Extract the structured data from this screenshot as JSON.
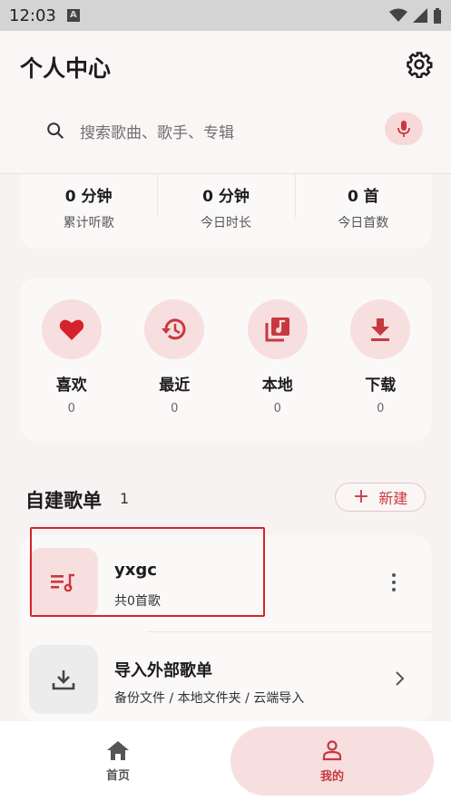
{
  "status_bar": {
    "time": "12:03"
  },
  "header": {
    "title": "个人中心",
    "search_placeholder": "搜索歌曲、歌手、专辑"
  },
  "stats": [
    {
      "value": "0 分钟",
      "label": "累计听歌"
    },
    {
      "value": "0 分钟",
      "label": "今日时长"
    },
    {
      "value": "0 首",
      "label": "今日首数"
    }
  ],
  "quick": [
    {
      "label": "喜欢",
      "count": "0",
      "icon": "heart-icon"
    },
    {
      "label": "最近",
      "count": "0",
      "icon": "history-icon"
    },
    {
      "label": "本地",
      "count": "0",
      "icon": "library-music-icon"
    },
    {
      "label": "下载",
      "count": "0",
      "icon": "download-icon"
    }
  ],
  "playlists": {
    "title": "自建歌单",
    "count": "1",
    "new_label": "新建",
    "items": [
      {
        "name": "yxgc",
        "sub": "共0首歌"
      },
      {
        "name": "导入外部歌单",
        "sub": "备份文件 / 本地文件夹 / 云端导入"
      }
    ]
  },
  "nav": {
    "home": "首页",
    "mine": "我的"
  },
  "colors": {
    "accent": "#c8393f",
    "accent_bg": "#f7dfe0",
    "highlight": "#d6232b"
  }
}
